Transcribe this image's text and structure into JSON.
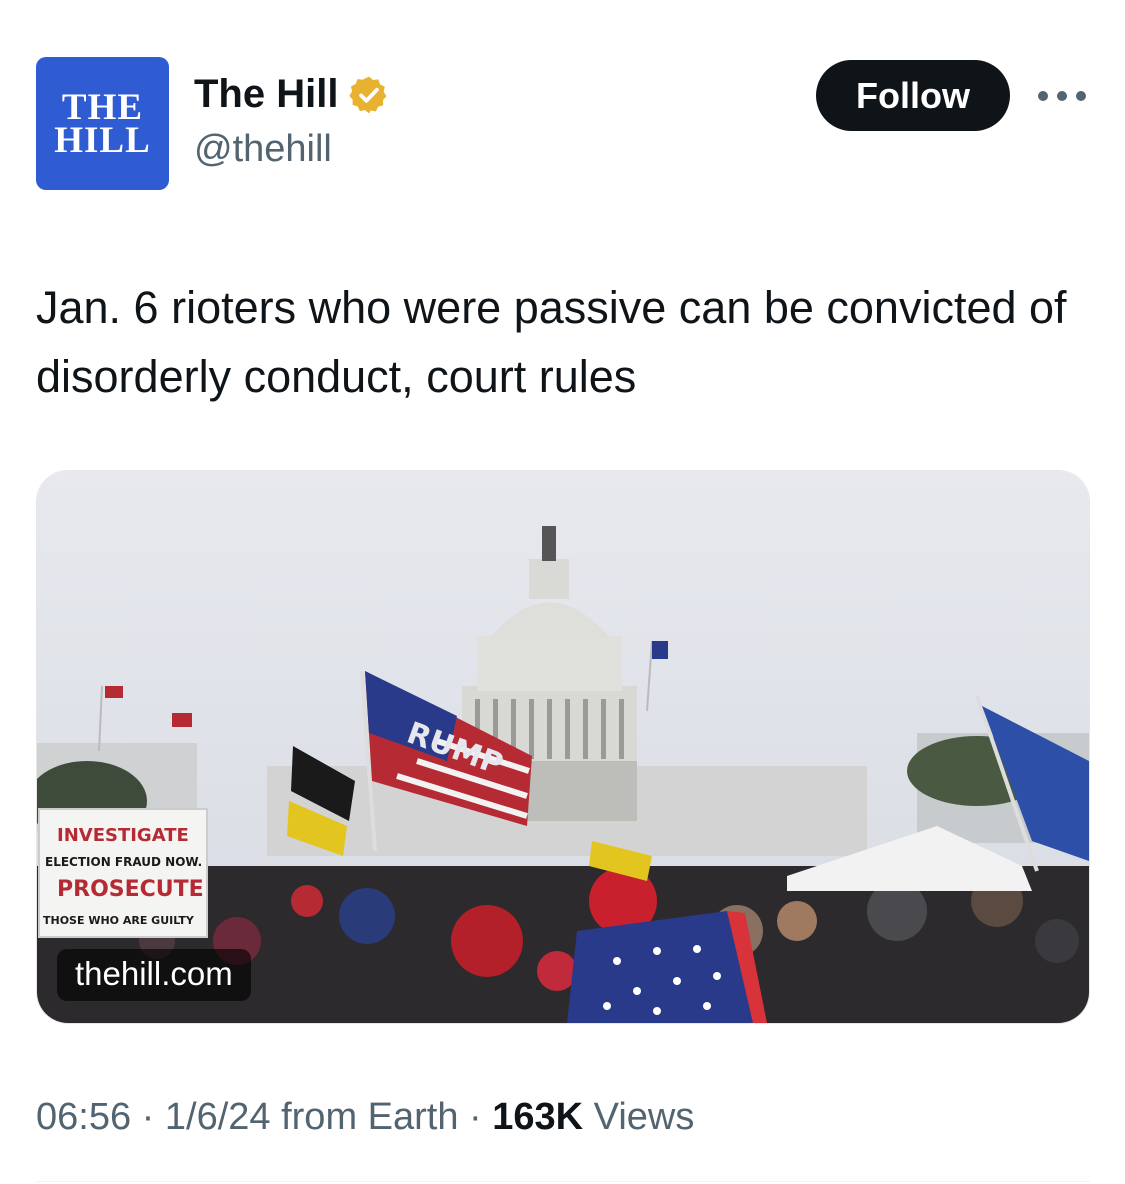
{
  "account": {
    "avatar_line1": "THE",
    "avatar_line2": "HILL",
    "display_name": "The Hill",
    "handle": "@thehill",
    "verified_icon": "verified-gold-badge-icon"
  },
  "actions": {
    "follow_label": "Follow",
    "more_icon": "more-horizontal-icon"
  },
  "tweet": {
    "text": "Jan. 6 rioters who were passive can be convicted of disorderly conduct, court rules"
  },
  "media": {
    "domain": "thehill.com",
    "sign_line1": "INVESTIGATE",
    "sign_line2": "ELECTION FRAUD NOW.",
    "sign_line3": "PROSECUTE",
    "sign_line4": "THOSE WHO ARE GUILTY",
    "flag_text": "RUMP"
  },
  "meta": {
    "time": "06:56",
    "date": "1/6/24",
    "source": "from Earth",
    "views_count": "163K",
    "views_label": "Views"
  },
  "colors": {
    "avatar_bg": "#2f5bd3",
    "follow_bg": "#0f1419",
    "badge": "#e8b130",
    "secondary_text": "#536471"
  }
}
